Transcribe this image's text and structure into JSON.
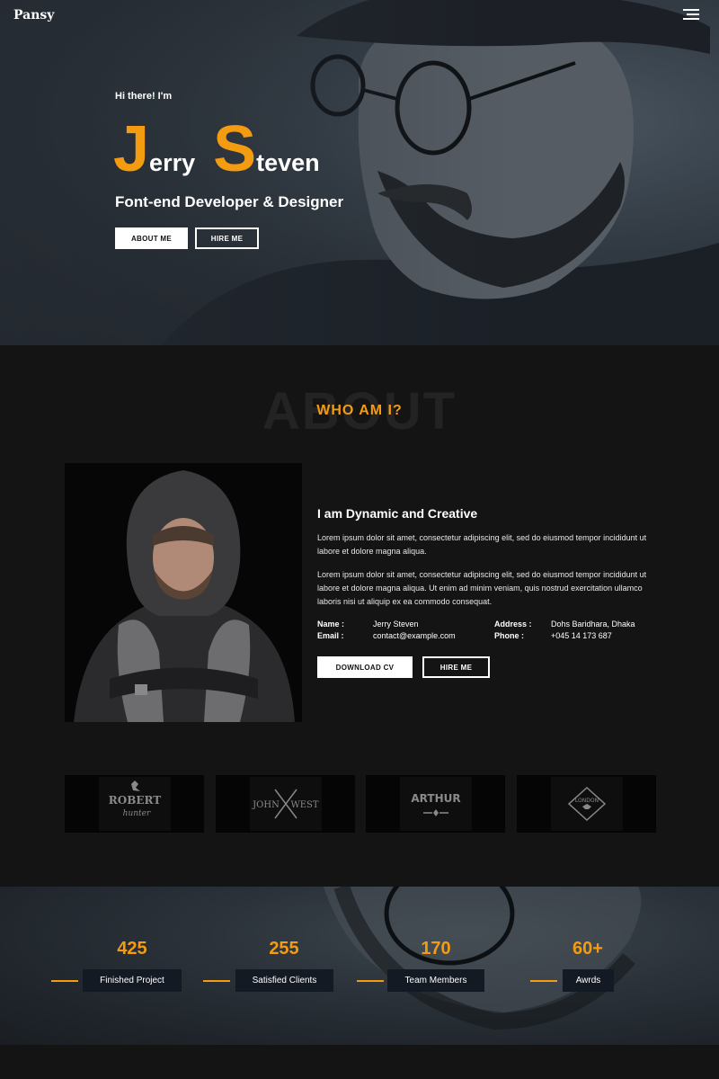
{
  "brand": {
    "logo": "Pansy"
  },
  "hero": {
    "greeting": "Hi there! I'm",
    "first_initial": "J",
    "first_rest": "erry",
    "last_initial": "S",
    "last_rest": "teven",
    "subtitle": "Font-end Developer & Designer",
    "about_button": "ABOUT ME",
    "hire_button": "HIRE ME"
  },
  "about": {
    "bg_word": "ABOUT",
    "heading": "WHO AM I?",
    "title": "I am Dynamic and Creative",
    "paragraph1": "Lorem ipsum dolor sit amet, consectetur adipiscing elit, sed do eiusmod tempor incididunt ut labore et dolore magna aliqua.",
    "paragraph2": "Lorem ipsum dolor sit amet, consectetur adipiscing elit, sed do eiusmod tempor incididunt ut labore et dolore magna aliqua. Ut enim ad minim veniam, quis nostrud exercitation ullamco laboris nisi ut aliquip ex ea commodo consequat.",
    "info": {
      "name_label": "Name :",
      "name_value": "Jerry Steven",
      "email_label": "Email :",
      "email_value": "contact@example.com",
      "address_label": "Address :",
      "address_value": "Dohs Baridhara, Dhaka",
      "phone_label": "Phone :",
      "phone_value": "+045 14 173 687"
    },
    "download_button": "DOWNLOAD CV",
    "hire_button": "HIRE ME"
  },
  "client_logos": [
    {
      "top": "ROBERT",
      "script": "hunter"
    },
    {
      "left": "JOHN",
      "right": "WEST"
    },
    {
      "top": "ARTHUR"
    },
    {
      "top": "LONDON"
    }
  ],
  "stats": [
    {
      "number": "425",
      "label": "Finished Project"
    },
    {
      "number": "255",
      "label": "Satisfied Clients"
    },
    {
      "number": "170",
      "label": "Team Members"
    },
    {
      "number": "60+",
      "label": "Awrds"
    }
  ],
  "colors": {
    "accent": "#f39c12",
    "dark": "#141414",
    "stat_box": "#131a24"
  }
}
